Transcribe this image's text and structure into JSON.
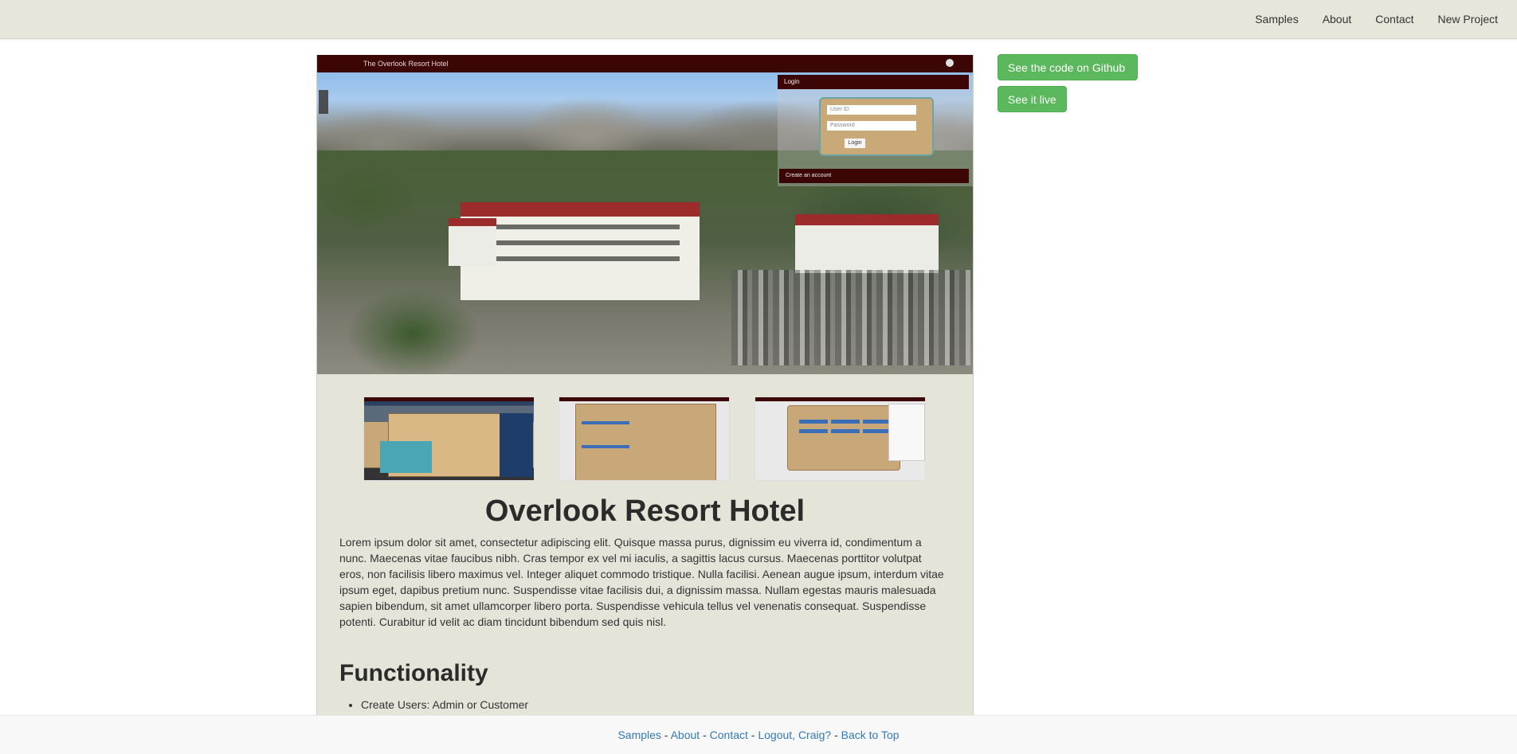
{
  "nav": {
    "links": [
      "Samples",
      "About",
      "Contact",
      "New Project"
    ]
  },
  "hero": {
    "app_title": "The Overlook Resort Hotel",
    "login_header": "Login",
    "user_id_placeholder": "User ID",
    "password_placeholder": "Password",
    "login_button": "Login",
    "create_account": "Create an account"
  },
  "project": {
    "title": "Overlook Resort Hotel",
    "description": "Lorem ipsum dolor sit amet, consectetur adipiscing elit. Quisque massa purus, dignissim eu viverra id, condimentum a nunc. Maecenas vitae faucibus nibh. Cras tempor ex vel mi iaculis, a sagittis lacus cursus. Maecenas porttitor volutpat eros, non facilisis libero maximus vel. Integer aliquet commodo tristique. Nulla facilisi. Aenean augue ipsum, interdum vitae ipsum eget, dapibus pretium nunc. Suspendisse vitae facilisis dui, a dignissim massa. Nullam egestas mauris malesuada sapien bibendum, sit amet ullamcorper libero porta. Suspendisse vehicula tellus vel venenatis consequat. Suspendisse potenti. Curabitur id velit ac diam tincidunt bibendum sed quis nisl.",
    "functionality_heading": "Functionality",
    "functionality_items": [
      "Create Users: Admin or Customer"
    ]
  },
  "actions": {
    "github_label": "See the code on Github",
    "live_label": "See it live",
    "button_color": "#5cb85c"
  },
  "footer": {
    "samples": "Samples",
    "about": "About",
    "contact": "Contact",
    "logout": "Logout, Craig?",
    "back_to_top": "Back to Top",
    "separator": " - "
  }
}
